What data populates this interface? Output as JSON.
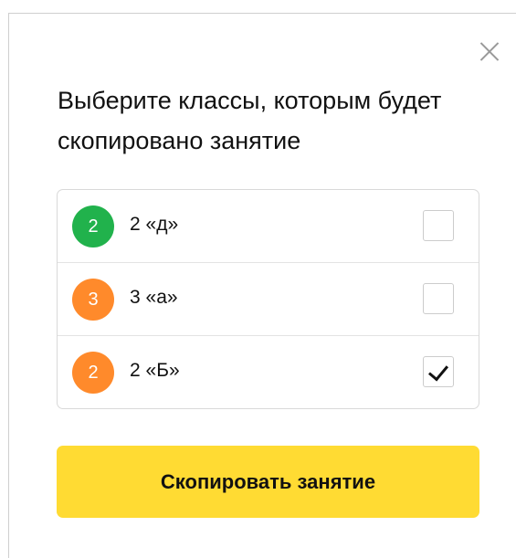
{
  "dialog": {
    "title": "Выберите классы, которым будет скопировано занятие",
    "close_icon": "close-icon"
  },
  "colors": {
    "green_badge": "#21b24c",
    "orange_badge": "#ff8a2b",
    "accent_button": "#ffdb33"
  },
  "classes": [
    {
      "badge_text": "2",
      "badge_color": "#21b24c",
      "label": "2 «д»",
      "checked": false
    },
    {
      "badge_text": "3",
      "badge_color": "#ff8a2b",
      "label": "3 «а»",
      "checked": false
    },
    {
      "badge_text": "2",
      "badge_color": "#ff8a2b",
      "label": "2 «Б»",
      "checked": true
    }
  ],
  "actions": {
    "copy_label": "Скопировать занятие"
  }
}
